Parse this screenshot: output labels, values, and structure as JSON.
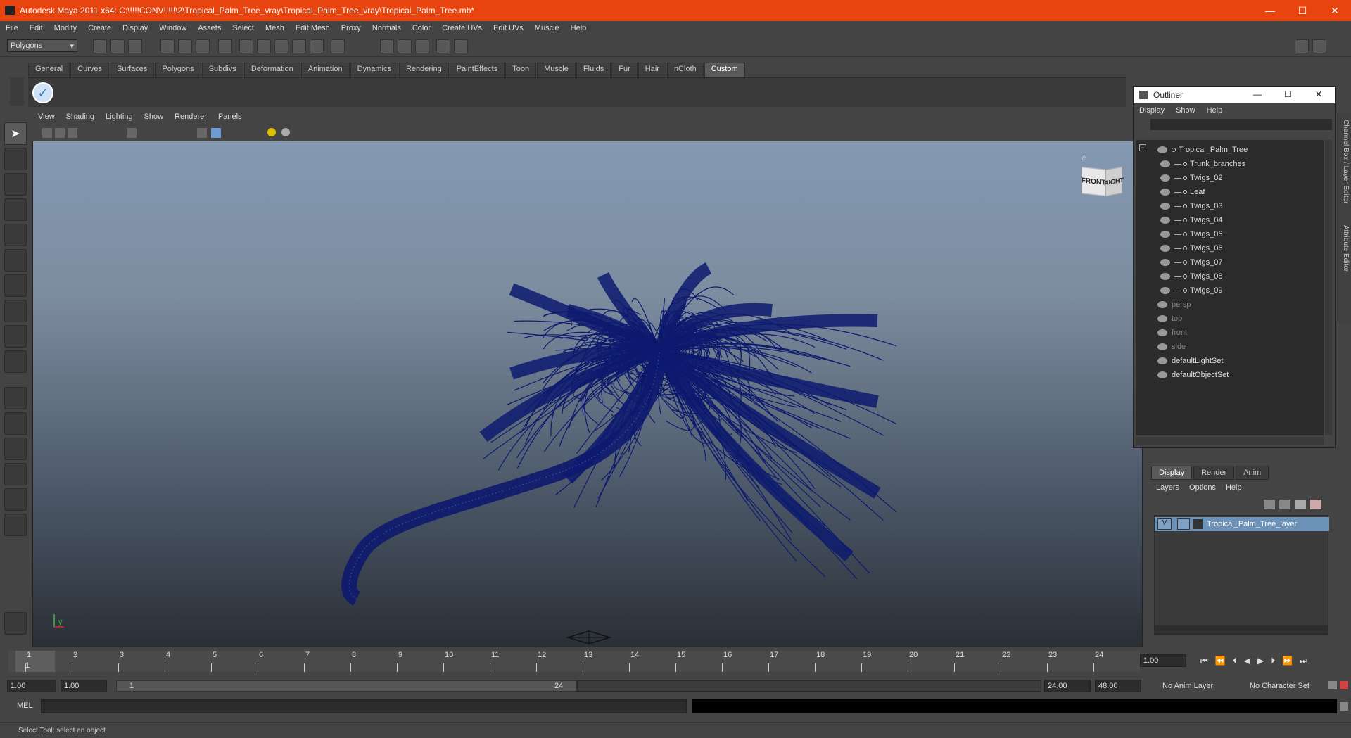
{
  "window": {
    "title": "Autodesk Maya 2011 x64: C:\\!!!!CONV!!!!!\\2\\Tropical_Palm_Tree_vray\\Tropical_Palm_Tree_vray\\Tropical_Palm_Tree.mb*",
    "minimize": "—",
    "maximize": "☐",
    "close": "✕"
  },
  "menu": [
    "File",
    "Edit",
    "Modify",
    "Create",
    "Display",
    "Window",
    "Assets",
    "Select",
    "Mesh",
    "Edit Mesh",
    "Proxy",
    "Normals",
    "Color",
    "Create UVs",
    "Edit UVs",
    "Muscle",
    "Help"
  ],
  "toolbar": {
    "mode": "Polygons"
  },
  "shelf_tabs": [
    "General",
    "Curves",
    "Surfaces",
    "Polygons",
    "Subdivs",
    "Deformation",
    "Animation",
    "Dynamics",
    "Rendering",
    "PaintEffects",
    "Toon",
    "Muscle",
    "Fluids",
    "Fur",
    "Hair",
    "nCloth",
    "Custom"
  ],
  "active_shelf": "Custom",
  "panel_menu": [
    "View",
    "Shading",
    "Lighting",
    "Show",
    "Renderer",
    "Panels"
  ],
  "viewcube": {
    "front": "FRONT",
    "right": "RIGHT"
  },
  "outliner": {
    "title": "Outliner",
    "menu": [
      "Display",
      "Show",
      "Help"
    ],
    "items": [
      {
        "label": "Tropical_Palm_Tree",
        "depth": 0,
        "dim": false
      },
      {
        "label": "Trunk_branches",
        "depth": 1,
        "dim": false
      },
      {
        "label": "Twigs_02",
        "depth": 1,
        "dim": false
      },
      {
        "label": "Leaf",
        "depth": 1,
        "dim": false
      },
      {
        "label": "Twigs_03",
        "depth": 1,
        "dim": false
      },
      {
        "label": "Twigs_04",
        "depth": 1,
        "dim": false
      },
      {
        "label": "Twigs_05",
        "depth": 1,
        "dim": false
      },
      {
        "label": "Twigs_06",
        "depth": 1,
        "dim": false
      },
      {
        "label": "Twigs_07",
        "depth": 1,
        "dim": false
      },
      {
        "label": "Twigs_08",
        "depth": 1,
        "dim": false
      },
      {
        "label": "Twigs_09",
        "depth": 1,
        "dim": false
      },
      {
        "label": "persp",
        "depth": 0,
        "dim": true
      },
      {
        "label": "top",
        "depth": 0,
        "dim": true
      },
      {
        "label": "front",
        "depth": 0,
        "dim": true
      },
      {
        "label": "side",
        "depth": 0,
        "dim": true
      },
      {
        "label": "defaultLightSet",
        "depth": 0,
        "dim": false
      },
      {
        "label": "defaultObjectSet",
        "depth": 0,
        "dim": false
      }
    ]
  },
  "side_tabs": {
    "channel_box": "Channel Box / Layer Editor",
    "attribute_editor": "Attribute Editor"
  },
  "layers": {
    "tabs": [
      "Display",
      "Render",
      "Anim"
    ],
    "menu": [
      "Layers",
      "Options",
      "Help"
    ],
    "layer": {
      "visible": "V",
      "name": "Tropical_Palm_Tree_layer"
    }
  },
  "timeline": {
    "ticks": [
      "1",
      "2",
      "3",
      "4",
      "5",
      "6",
      "7",
      "8",
      "9",
      "10",
      "11",
      "12",
      "13",
      "14",
      "15",
      "16",
      "17",
      "18",
      "19",
      "20",
      "21",
      "22",
      "23",
      "24"
    ],
    "current": "1",
    "current_field": "1.00"
  },
  "range": {
    "start": "1.00",
    "start2": "1.00",
    "slider_start": "1",
    "slider_end": "24",
    "end": "24.00",
    "end2": "48.00",
    "anim_layer": "No Anim Layer",
    "char_set": "No Character Set"
  },
  "mel": {
    "label": "MEL"
  },
  "help_line": "Select Tool: select an object",
  "colors": {
    "title_bar": "#e8440f",
    "mesh": "#0d1a6e",
    "layer_highlight": "#6d92b8"
  }
}
